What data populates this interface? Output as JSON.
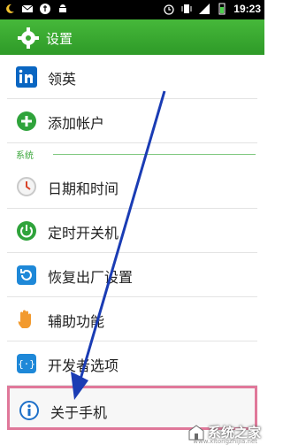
{
  "status_bar": {
    "time": "19:23",
    "icons_left": [
      "moon-icon",
      "mail-icon",
      "usb-icon",
      "android-icon"
    ],
    "icons_right": [
      "alarm-icon",
      "vibrate-icon",
      "signal-icon",
      "battery-icon"
    ]
  },
  "header": {
    "title": "设置",
    "icon": "gear-icon",
    "color": "#3aa932"
  },
  "settings": {
    "items_top": [
      {
        "label": "领英",
        "icon": "linkedin-icon"
      },
      {
        "label": "添加帐户",
        "icon": "plus-circle-icon"
      }
    ],
    "section_label": "系统",
    "items_system": [
      {
        "label": "日期和时间",
        "icon": "clock-icon"
      },
      {
        "label": "定时开关机",
        "icon": "power-icon"
      },
      {
        "label": "恢复出厂设置",
        "icon": "restore-icon"
      },
      {
        "label": "辅助功能",
        "icon": "hand-icon"
      },
      {
        "label": "开发者选项",
        "icon": "braces-icon"
      },
      {
        "label": "关于手机",
        "icon": "info-icon"
      }
    ]
  },
  "highlight_color": "#e0789a",
  "arrow_color": "#1a3cb4",
  "watermark": {
    "text": "系统之家",
    "sub": "www.xitongzhijia.net"
  }
}
